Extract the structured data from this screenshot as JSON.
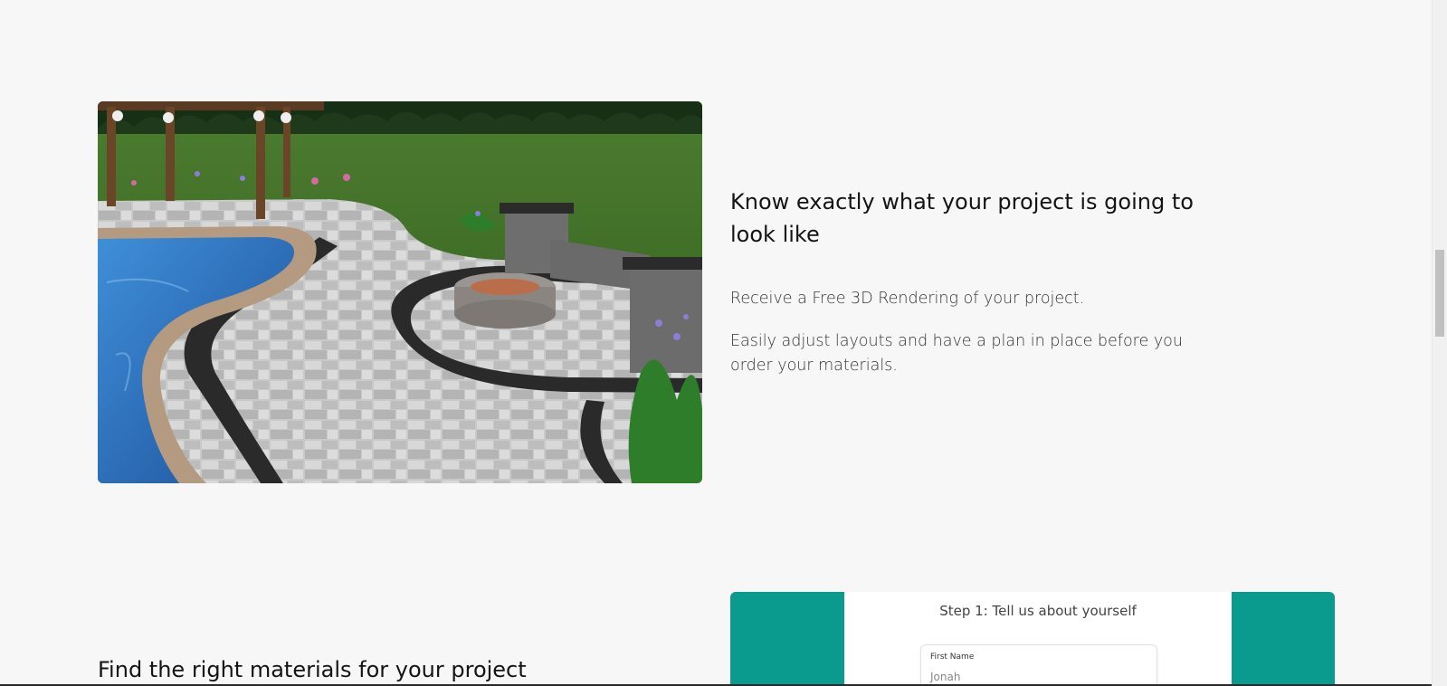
{
  "section1": {
    "image_alt": "3D rendering of a paver patio with pool, fire pit and pergola",
    "heading": "Know exactly what your project is going to look like",
    "paragraph1": "Receive a Free 3D Rendering of your project.",
    "paragraph2": "Easily adjust layouts and have a plan in place before you order your materials."
  },
  "section2": {
    "heading": "Find the right materials for your project",
    "form_preview": {
      "step_title": "Step 1: Tell us about yourself",
      "field_label": "First Name",
      "field_value": "Jonah"
    }
  },
  "colors": {
    "background": "#f7f7f7",
    "teal": "#0a9a8e"
  }
}
